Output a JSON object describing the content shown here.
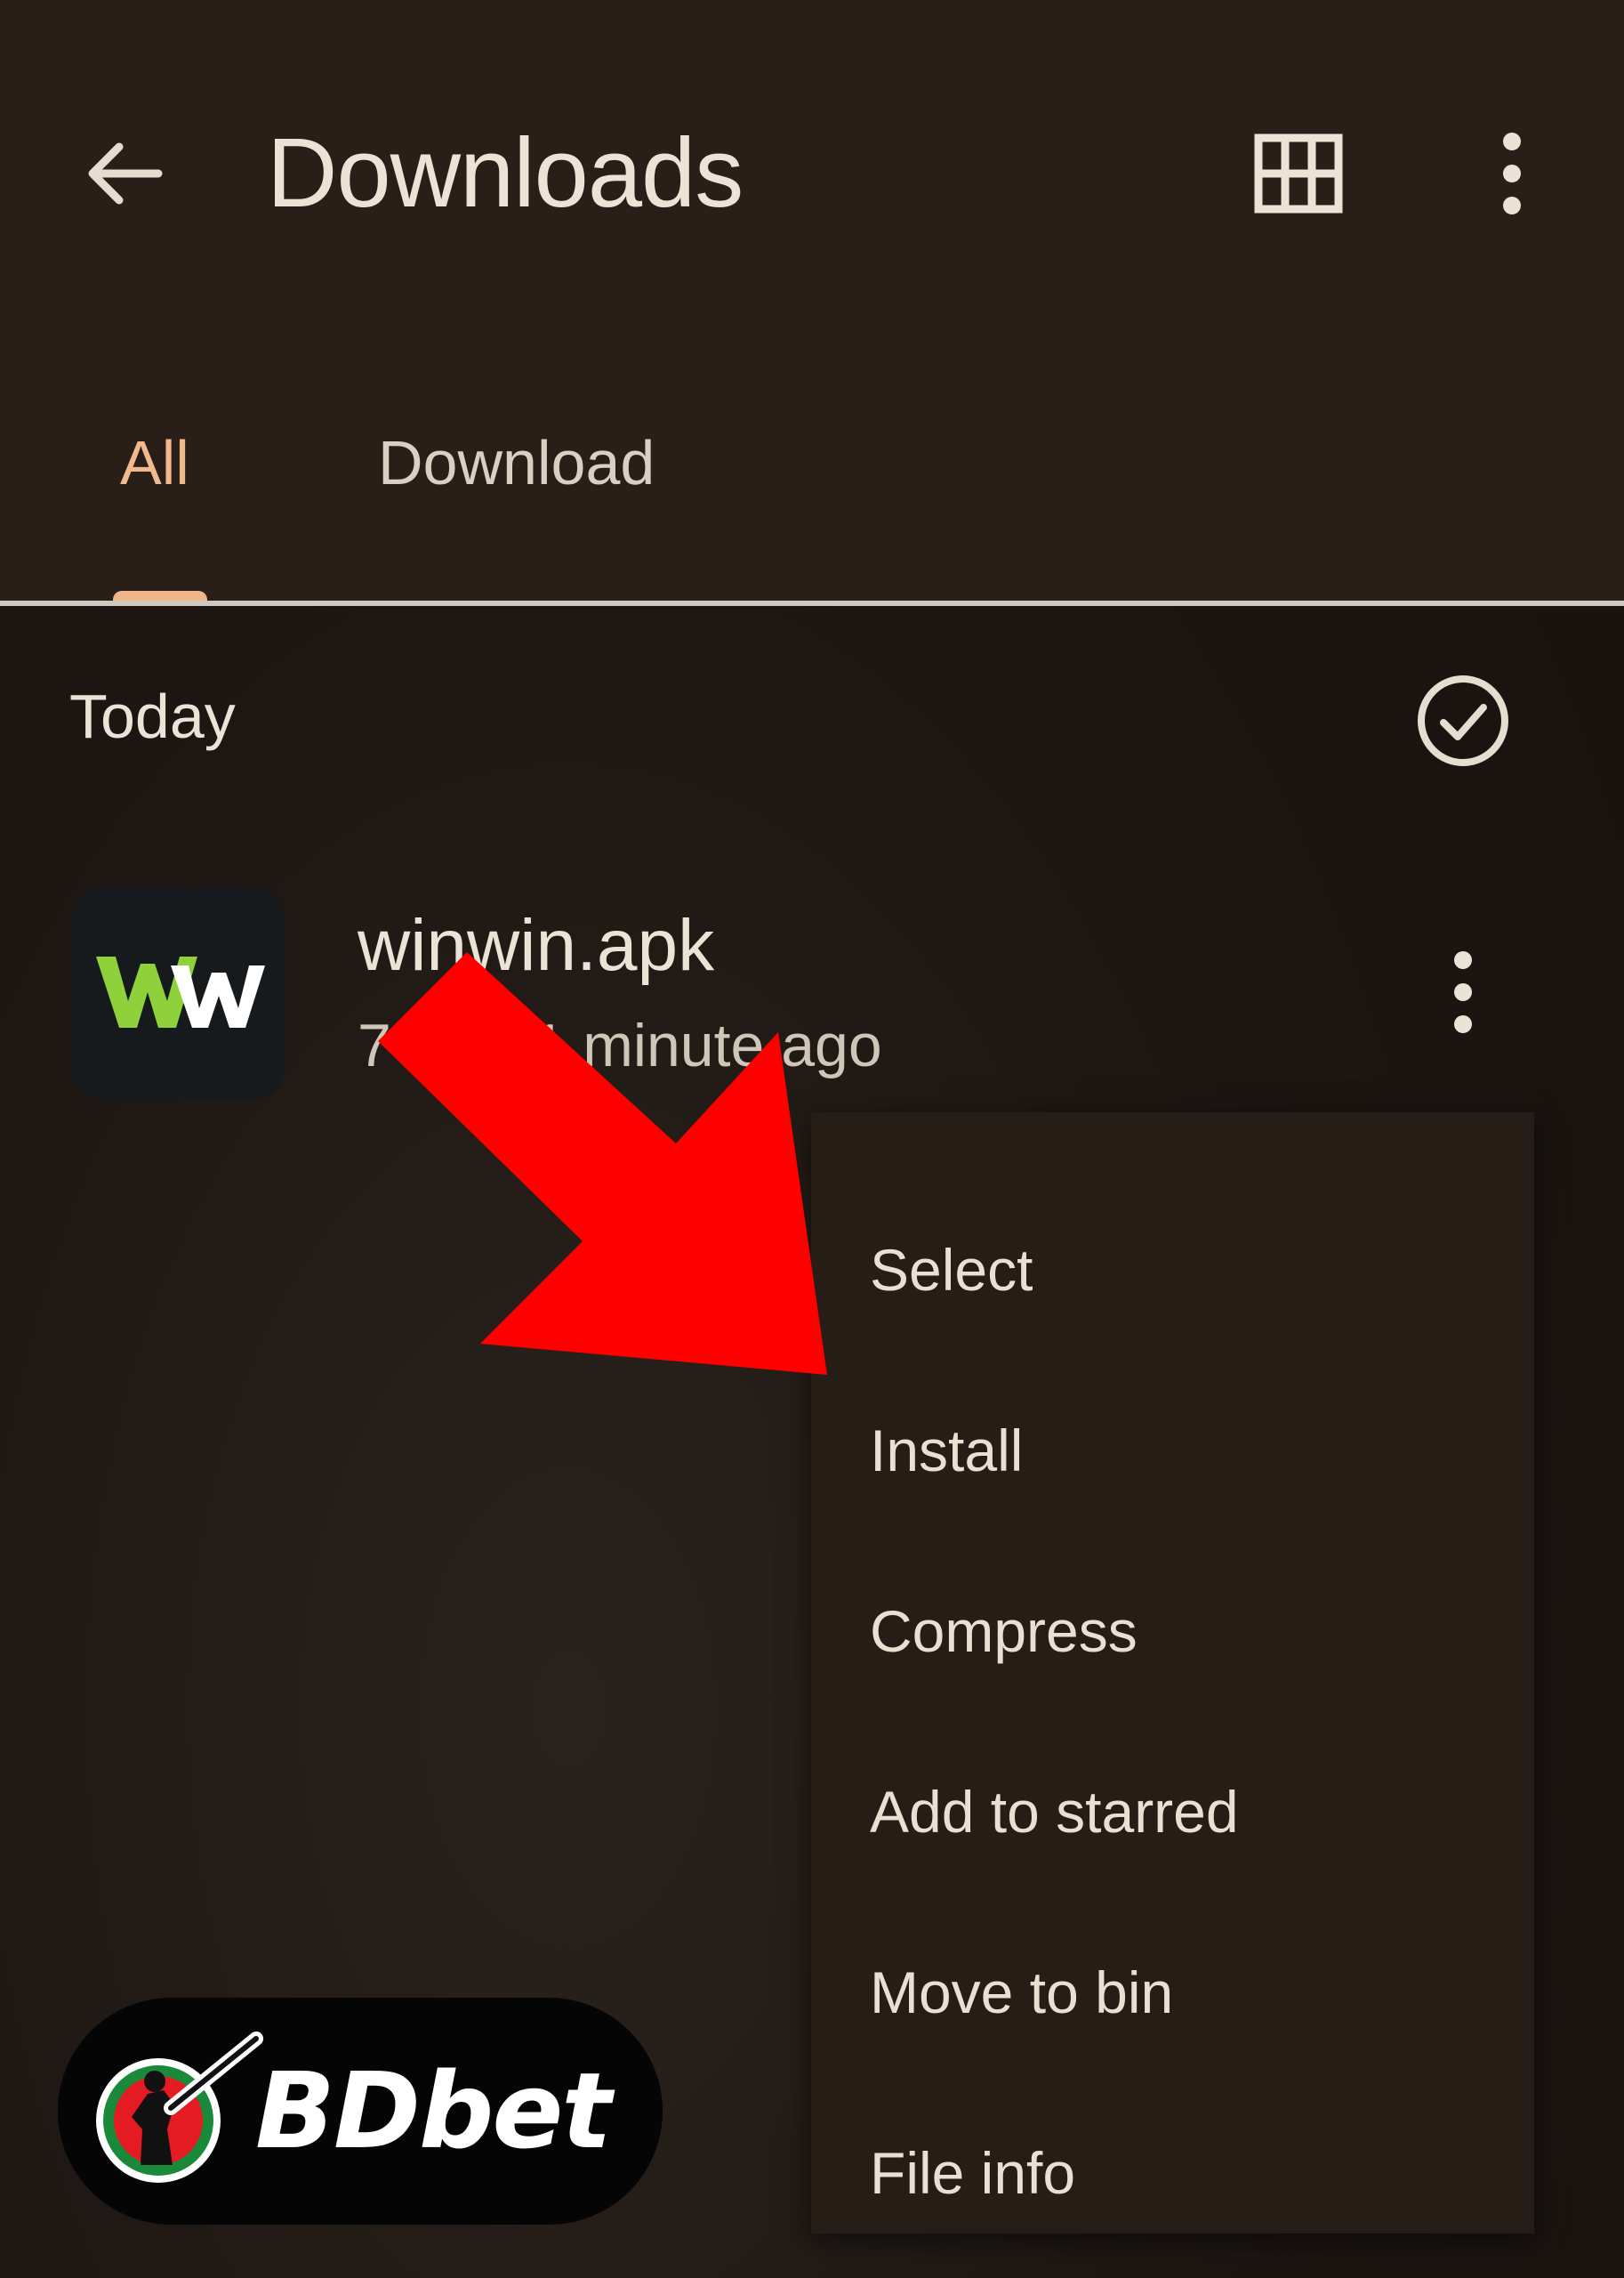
{
  "header": {
    "title": "Downloads",
    "back_icon": "arrow-left-icon",
    "view_icon": "grid-view-icon",
    "more_icon": "more-vert-icon"
  },
  "tabs": [
    {
      "label": "All",
      "active": true
    },
    {
      "label": "Download",
      "active": false
    }
  ],
  "section": {
    "title": "Today",
    "select_all_icon": "check-circle-icon"
  },
  "file": {
    "name": "winwin.apk",
    "meta": "7 MB, 1 minute ago",
    "thumb_text": "WW",
    "more_icon": "more-vert-icon"
  },
  "menu": {
    "items": [
      {
        "label": "Select"
      },
      {
        "label": "Install"
      },
      {
        "label": "Compress"
      },
      {
        "label": "Add to starred"
      },
      {
        "label": "Move to bin"
      },
      {
        "label": "File info"
      }
    ]
  },
  "overlay": {
    "arrow_color": "#ff0000",
    "arrow_icon": "red-arrow-pointer-icon"
  },
  "badge": {
    "text": "BDbet",
    "logo_icon": "cricket-player-logo-icon"
  },
  "colors": {
    "accent": "#f2b98d",
    "background": "#1b1411",
    "appbar": "#2a1f18",
    "menu": "#261d17"
  }
}
